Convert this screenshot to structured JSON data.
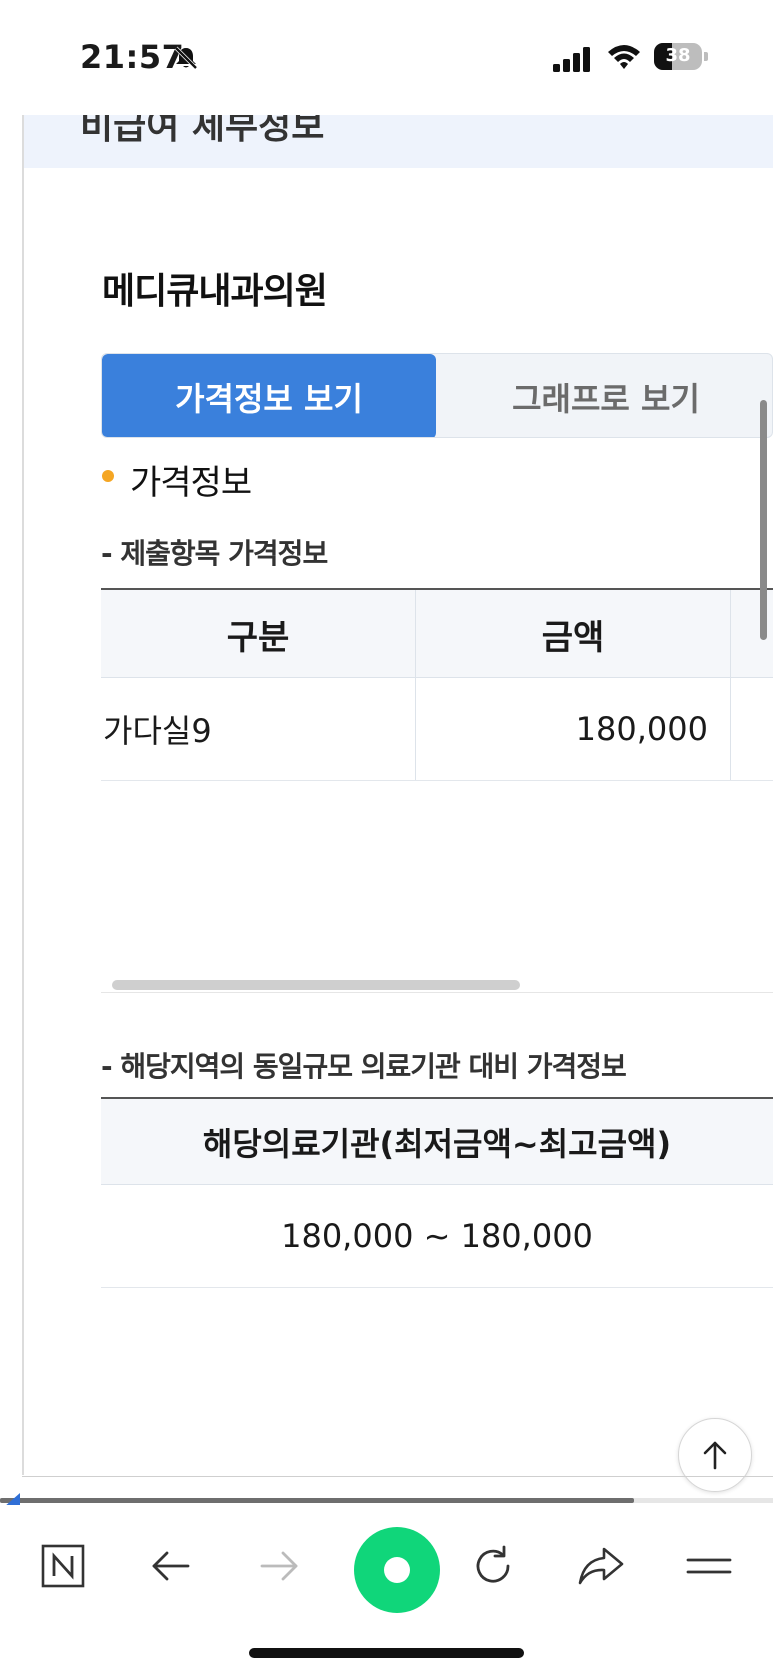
{
  "status_bar": {
    "time": "21:57",
    "battery_level": "38",
    "battery_fraction": 0.38
  },
  "header_band": {
    "partial_title": "비급여 세부정보"
  },
  "hospital": {
    "name": "메디큐내과의원"
  },
  "tabs": [
    {
      "label": "가격정보 보기",
      "active": true
    },
    {
      "label": "그래프로 보기",
      "active": false
    }
  ],
  "section": {
    "title": "가격정보"
  },
  "price_table": {
    "subtitle": "- 제출항목 가격정보",
    "headers": [
      "구분",
      "금액"
    ],
    "rows": [
      {
        "category": "가다실9",
        "amount": "180,000"
      }
    ]
  },
  "region_table": {
    "subtitle": "- 해당지역의 동일규모 의료기관 대비 가격정보",
    "header": "해당의료기관(최저금액~최고금액)",
    "value": "180,000 ~ 180,000"
  },
  "page_progress_fraction": 0.82,
  "toolbar": {
    "items": [
      {
        "icon": "naver-n-icon"
      },
      {
        "icon": "back-arrow-icon"
      },
      {
        "icon": "forward-arrow-icon"
      },
      {
        "icon": "green-dot-home-icon"
      },
      {
        "icon": "reload-icon"
      },
      {
        "icon": "share-icon"
      },
      {
        "icon": "menu-icon"
      }
    ]
  },
  "colors": {
    "accent_blue": "#3a80dc",
    "section_dot": "#f5a623",
    "toolbar_green": "#10d67a",
    "header_band": "#eef3fc"
  }
}
